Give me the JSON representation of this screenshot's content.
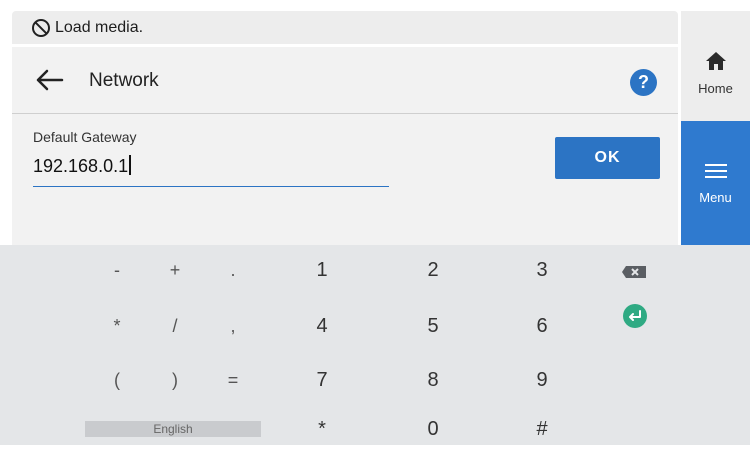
{
  "status": {
    "icon": "no-media-icon",
    "text": "Load media."
  },
  "header": {
    "title": "Network",
    "back_icon": "back-arrow-icon",
    "help_icon": "help-icon",
    "help_glyph": "?"
  },
  "field": {
    "label": "Default Gateway",
    "value": "192.168.0.1"
  },
  "ok_label": "OK",
  "side_nav": {
    "home_label": "Home",
    "menu_label": "Menu"
  },
  "keypad": {
    "row1": [
      "-",
      "+",
      ".",
      "1",
      "2",
      "3"
    ],
    "row2": [
      "*",
      "/",
      ",",
      "4",
      "5",
      "6"
    ],
    "row3": [
      "(",
      ")",
      "=",
      "7",
      "8",
      "9"
    ],
    "row4": [
      "*",
      "0",
      "#"
    ],
    "language": "English",
    "backspace_icon": "backspace-icon",
    "enter_icon": "enter-icon"
  },
  "colors": {
    "accent": "#2c74c4",
    "menu_bg": "#2f7acf",
    "enter_green": "#2faa83"
  }
}
